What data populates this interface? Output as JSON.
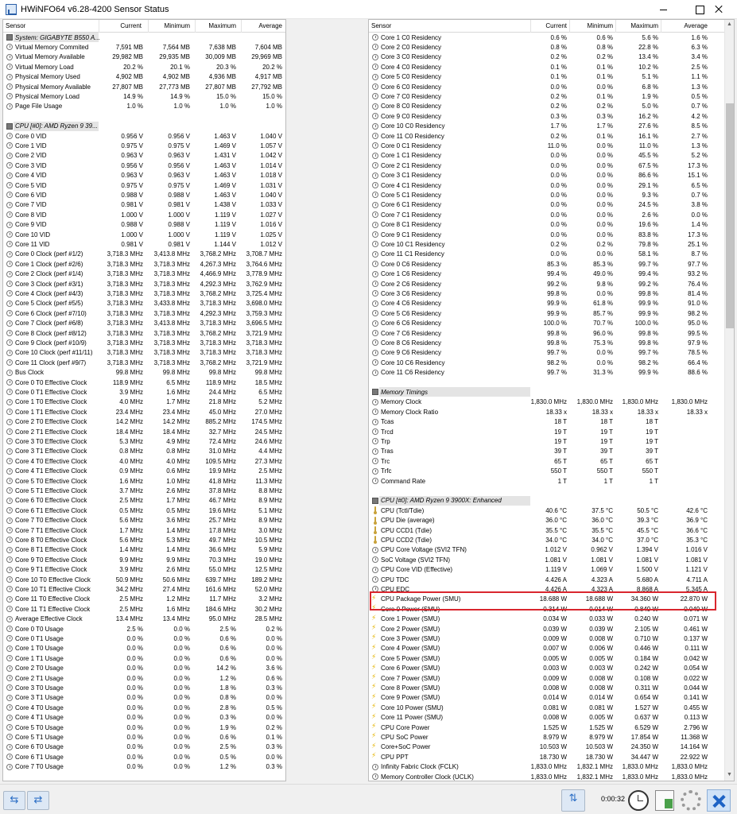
{
  "window": {
    "title": "HWiNFO64 v6.28-4200 Sensor Status"
  },
  "columns": [
    "Sensor",
    "Current",
    "Minimum",
    "Maximum",
    "Average"
  ],
  "left_rows": [
    [
      "group",
      "System: GIGABYTE B550 A..."
    ],
    [
      "circle",
      "Virtual Memory Commited",
      "7,591 MB",
      "7,564 MB",
      "7,638 MB",
      "7,604 MB"
    ],
    [
      "circle",
      "Virtual Memory Available",
      "29,982 MB",
      "29,935 MB",
      "30,009 MB",
      "29,969 MB"
    ],
    [
      "circle",
      "Virtual Memory Load",
      "20.2 %",
      "20.1 %",
      "20.3 %",
      "20.2 %"
    ],
    [
      "circle",
      "Physical Memory Used",
      "4,902 MB",
      "4,902 MB",
      "4,936 MB",
      "4,917 MB"
    ],
    [
      "circle",
      "Physical Memory Available",
      "27,807 MB",
      "27,773 MB",
      "27,807 MB",
      "27,792 MB"
    ],
    [
      "circle",
      "Physical Memory Load",
      "14.9 %",
      "14.9 %",
      "15.0 %",
      "15.0 %"
    ],
    [
      "circle",
      "Page File Usage",
      "1.0 %",
      "1.0 %",
      "1.0 %",
      "1.0 %"
    ],
    [
      "gap"
    ],
    [
      "group",
      "CPU [#0]: AMD Ryzen 9 39..."
    ],
    [
      "circle",
      "Core 0 VID",
      "0.956 V",
      "0.956 V",
      "1.463 V",
      "1.040 V"
    ],
    [
      "circle",
      "Core 1 VID",
      "0.975 V",
      "0.975 V",
      "1.469 V",
      "1.057 V"
    ],
    [
      "circle",
      "Core 2 VID",
      "0.963 V",
      "0.963 V",
      "1.431 V",
      "1.042 V"
    ],
    [
      "circle",
      "Core 3 VID",
      "0.956 V",
      "0.956 V",
      "1.463 V",
      "1.014 V"
    ],
    [
      "circle",
      "Core 4 VID",
      "0.963 V",
      "0.963 V",
      "1.463 V",
      "1.018 V"
    ],
    [
      "circle",
      "Core 5 VID",
      "0.975 V",
      "0.975 V",
      "1.469 V",
      "1.031 V"
    ],
    [
      "circle",
      "Core 6 VID",
      "0.988 V",
      "0.988 V",
      "1.463 V",
      "1.040 V"
    ],
    [
      "circle",
      "Core 7 VID",
      "0.981 V",
      "0.981 V",
      "1.438 V",
      "1.033 V"
    ],
    [
      "circle",
      "Core 8 VID",
      "1.000 V",
      "1.000 V",
      "1.119 V",
      "1.027 V"
    ],
    [
      "circle",
      "Core 9 VID",
      "0.988 V",
      "0.988 V",
      "1.119 V",
      "1.016 V"
    ],
    [
      "circle",
      "Core 10 VID",
      "1.000 V",
      "1.000 V",
      "1.119 V",
      "1.025 V"
    ],
    [
      "circle",
      "Core 11 VID",
      "0.981 V",
      "0.981 V",
      "1.144 V",
      "1.012 V"
    ],
    [
      "circle",
      "Core 0 Clock (perf #1/2)",
      "3,718.3 MHz",
      "3,413.8 MHz",
      "3,768.2 MHz",
      "3,708.7 MHz"
    ],
    [
      "circle",
      "Core 1 Clock (perf #2/6)",
      "3,718.3 MHz",
      "3,718.3 MHz",
      "4,267.3 MHz",
      "3,764.6 MHz"
    ],
    [
      "circle",
      "Core 2 Clock (perf #1/4)",
      "3,718.3 MHz",
      "3,718.3 MHz",
      "4,466.9 MHz",
      "3,778.9 MHz"
    ],
    [
      "circle",
      "Core 3 Clock (perf #3/1)",
      "3,718.3 MHz",
      "3,718.3 MHz",
      "4,292.3 MHz",
      "3,762.9 MHz"
    ],
    [
      "circle",
      "Core 4 Clock (perf #4/3)",
      "3,718.3 MHz",
      "3,718.3 MHz",
      "3,768.2 MHz",
      "3,725.4 MHz"
    ],
    [
      "circle",
      "Core 5 Clock (perf #5/5)",
      "3,718.3 MHz",
      "3,433.8 MHz",
      "3,718.3 MHz",
      "3,698.0 MHz"
    ],
    [
      "circle",
      "Core 6 Clock (perf #7/10)",
      "3,718.3 MHz",
      "3,718.3 MHz",
      "4,292.3 MHz",
      "3,759.3 MHz"
    ],
    [
      "circle",
      "Core 7 Clock (perf #6/8)",
      "3,718.3 MHz",
      "3,413.8 MHz",
      "3,718.3 MHz",
      "3,696.5 MHz"
    ],
    [
      "circle",
      "Core 8 Clock (perf #8/12)",
      "3,718.3 MHz",
      "3,718.3 MHz",
      "3,768.2 MHz",
      "3,721.9 MHz"
    ],
    [
      "circle",
      "Core 9 Clock (perf #10/9)",
      "3,718.3 MHz",
      "3,718.3 MHz",
      "3,718.3 MHz",
      "3,718.3 MHz"
    ],
    [
      "circle",
      "Core 10 Clock (perf #11/11)",
      "3,718.3 MHz",
      "3,718.3 MHz",
      "3,718.3 MHz",
      "3,718.3 MHz"
    ],
    [
      "circle",
      "Core 11 Clock (perf #9/7)",
      "3,718.3 MHz",
      "3,718.3 MHz",
      "3,768.2 MHz",
      "3,721.9 MHz"
    ],
    [
      "circle",
      "Bus Clock",
      "99.8 MHz",
      "99.8 MHz",
      "99.8 MHz",
      "99.8 MHz"
    ],
    [
      "circle",
      "Core 0 T0 Effective Clock",
      "118.9 MHz",
      "6.5 MHz",
      "118.9 MHz",
      "18.5 MHz"
    ],
    [
      "circle",
      "Core 0 T1 Effective Clock",
      "3.9 MHz",
      "1.6 MHz",
      "24.4 MHz",
      "6.5 MHz"
    ],
    [
      "circle",
      "Core 1 T0 Effective Clock",
      "4.0 MHz",
      "1.7 MHz",
      "21.8 MHz",
      "5.2 MHz"
    ],
    [
      "circle",
      "Core 1 T1 Effective Clock",
      "23.4 MHz",
      "23.4 MHz",
      "45.0 MHz",
      "27.0 MHz"
    ],
    [
      "circle",
      "Core 2 T0 Effective Clock",
      "14.2 MHz",
      "14.2 MHz",
      "885.2 MHz",
      "174.5 MHz"
    ],
    [
      "circle",
      "Core 2 T1 Effective Clock",
      "18.4 MHz",
      "18.4 MHz",
      "32.7 MHz",
      "24.5 MHz"
    ],
    [
      "circle",
      "Core 3 T0 Effective Clock",
      "5.3 MHz",
      "4.9 MHz",
      "72.4 MHz",
      "24.6 MHz"
    ],
    [
      "circle",
      "Core 3 T1 Effective Clock",
      "0.8 MHz",
      "0.8 MHz",
      "31.0 MHz",
      "4.4 MHz"
    ],
    [
      "circle",
      "Core 4 T0 Effective Clock",
      "4.0 MHz",
      "4.0 MHz",
      "109.5 MHz",
      "27.3 MHz"
    ],
    [
      "circle",
      "Core 4 T1 Effective Clock",
      "0.9 MHz",
      "0.6 MHz",
      "19.9 MHz",
      "2.5 MHz"
    ],
    [
      "circle",
      "Core 5 T0 Effective Clock",
      "1.6 MHz",
      "1.0 MHz",
      "41.8 MHz",
      "11.3 MHz"
    ],
    [
      "circle",
      "Core 5 T1 Effective Clock",
      "3.7 MHz",
      "2.6 MHz",
      "37.8 MHz",
      "8.8 MHz"
    ],
    [
      "circle",
      "Core 6 T0 Effective Clock",
      "2.5 MHz",
      "1.7 MHz",
      "46.7 MHz",
      "8.9 MHz"
    ],
    [
      "circle",
      "Core 6 T1 Effective Clock",
      "0.5 MHz",
      "0.5 MHz",
      "19.6 MHz",
      "5.1 MHz"
    ],
    [
      "circle",
      "Core 7 T0 Effective Clock",
      "5.6 MHz",
      "3.6 MHz",
      "25.7 MHz",
      "8.9 MHz"
    ],
    [
      "circle",
      "Core 7 T1 Effective Clock",
      "1.7 MHz",
      "1.4 MHz",
      "17.8 MHz",
      "3.0 MHz"
    ],
    [
      "circle",
      "Core 8 T0 Effective Clock",
      "5.6 MHz",
      "5.3 MHz",
      "49.7 MHz",
      "10.5 MHz"
    ],
    [
      "circle",
      "Core 8 T1 Effective Clock",
      "1.4 MHz",
      "1.4 MHz",
      "36.6 MHz",
      "5.9 MHz"
    ],
    [
      "circle",
      "Core 9 T0 Effective Clock",
      "9.9 MHz",
      "9.9 MHz",
      "70.3 MHz",
      "19.0 MHz"
    ],
    [
      "circle",
      "Core 9 T1 Effective Clock",
      "3.9 MHz",
      "2.6 MHz",
      "55.0 MHz",
      "12.5 MHz"
    ],
    [
      "circle",
      "Core 10 T0 Effective Clock",
      "50.9 MHz",
      "50.6 MHz",
      "639.7 MHz",
      "189.2 MHz"
    ],
    [
      "circle",
      "Core 10 T1 Effective Clock",
      "34.2 MHz",
      "27.4 MHz",
      "161.6 MHz",
      "52.0 MHz"
    ],
    [
      "circle",
      "Core 11 T0 Effective Clock",
      "2.5 MHz",
      "1.2 MHz",
      "11.7 MHz",
      "3.2 MHz"
    ],
    [
      "circle",
      "Core 11 T1 Effective Clock",
      "2.5 MHz",
      "1.6 MHz",
      "184.6 MHz",
      "30.2 MHz"
    ],
    [
      "circle",
      "Average Effective Clock",
      "13.4 MHz",
      "13.4 MHz",
      "95.0 MHz",
      "28.5 MHz"
    ],
    [
      "circle",
      "Core 0 T0 Usage",
      "2.5 %",
      "0.0 %",
      "2.5 %",
      "0.2 %"
    ],
    [
      "circle",
      "Core 0 T1 Usage",
      "0.0 %",
      "0.0 %",
      "0.6 %",
      "0.0 %"
    ],
    [
      "circle",
      "Core 1 T0 Usage",
      "0.0 %",
      "0.0 %",
      "0.6 %",
      "0.0 %"
    ],
    [
      "circle",
      "Core 1 T1 Usage",
      "0.0 %",
      "0.0 %",
      "0.6 %",
      "0.0 %"
    ],
    [
      "circle",
      "Core 2 T0 Usage",
      "0.0 %",
      "0.0 %",
      "14.2 %",
      "3.6 %"
    ],
    [
      "circle",
      "Core 2 T1 Usage",
      "0.0 %",
      "0.0 %",
      "1.2 %",
      "0.6 %"
    ],
    [
      "circle",
      "Core 3 T0 Usage",
      "0.0 %",
      "0.0 %",
      "1.8 %",
      "0.3 %"
    ],
    [
      "circle",
      "Core 3 T1 Usage",
      "0.0 %",
      "0.0 %",
      "0.8 %",
      "0.0 %"
    ],
    [
      "circle",
      "Core 4 T0 Usage",
      "0.0 %",
      "0.0 %",
      "2.8 %",
      "0.5 %"
    ],
    [
      "circle",
      "Core 4 T1 Usage",
      "0.0 %",
      "0.0 %",
      "0.3 %",
      "0.0 %"
    ],
    [
      "circle",
      "Core 5 T0 Usage",
      "0.0 %",
      "0.0 %",
      "1.9 %",
      "0.2 %"
    ],
    [
      "circle",
      "Core 5 T1 Usage",
      "0.0 %",
      "0.0 %",
      "0.6 %",
      "0.1 %"
    ],
    [
      "circle",
      "Core 6 T0 Usage",
      "0.0 %",
      "0.0 %",
      "2.5 %",
      "0.3 %"
    ],
    [
      "circle",
      "Core 6 T1 Usage",
      "0.0 %",
      "0.0 %",
      "0.5 %",
      "0.0 %"
    ],
    [
      "circle",
      "Core 7 T0 Usage",
      "0.0 %",
      "0.0 %",
      "1.2 %",
      "0.3 %"
    ]
  ],
  "right_rows": [
    [
      "circle",
      "Core 1 C0 Residency",
      "0.6 %",
      "0.6 %",
      "5.6 %",
      "1.6 %"
    ],
    [
      "circle",
      "Core 2 C0 Residency",
      "0.8 %",
      "0.8 %",
      "22.8 %",
      "6.3 %"
    ],
    [
      "circle",
      "Core 3 C0 Residency",
      "0.2 %",
      "0.2 %",
      "13.4 %",
      "3.4 %"
    ],
    [
      "circle",
      "Core 4 C0 Residency",
      "0.1 %",
      "0.1 %",
      "10.2 %",
      "2.5 %"
    ],
    [
      "circle",
      "Core 5 C0 Residency",
      "0.1 %",
      "0.1 %",
      "5.1 %",
      "1.1 %"
    ],
    [
      "circle",
      "Core 6 C0 Residency",
      "0.0 %",
      "0.0 %",
      "6.8 %",
      "1.3 %"
    ],
    [
      "circle",
      "Core 7 C0 Residency",
      "0.2 %",
      "0.1 %",
      "1.9 %",
      "0.5 %"
    ],
    [
      "circle",
      "Core 8 C0 Residency",
      "0.2 %",
      "0.2 %",
      "5.0 %",
      "0.7 %"
    ],
    [
      "circle",
      "Core 9 C0 Residency",
      "0.3 %",
      "0.3 %",
      "16.2 %",
      "4.2 %"
    ],
    [
      "circle",
      "Core 10 C0 Residency",
      "1.7 %",
      "1.7 %",
      "27.6 %",
      "8.5 %"
    ],
    [
      "circle",
      "Core 11 C0 Residency",
      "0.2 %",
      "0.1 %",
      "16.1 %",
      "2.7 %"
    ],
    [
      "circle",
      "Core 0 C1 Residency",
      "11.0 %",
      "0.0 %",
      "11.0 %",
      "1.3 %"
    ],
    [
      "circle",
      "Core 1 C1 Residency",
      "0.0 %",
      "0.0 %",
      "45.5 %",
      "5.2 %"
    ],
    [
      "circle",
      "Core 2 C1 Residency",
      "0.0 %",
      "0.0 %",
      "67.5 %",
      "17.3 %"
    ],
    [
      "circle",
      "Core 3 C1 Residency",
      "0.0 %",
      "0.0 %",
      "86.6 %",
      "15.1 %"
    ],
    [
      "circle",
      "Core 4 C1 Residency",
      "0.0 %",
      "0.0 %",
      "29.1 %",
      "6.5 %"
    ],
    [
      "circle",
      "Core 5 C1 Residency",
      "0.0 %",
      "0.0 %",
      "9.3 %",
      "0.7 %"
    ],
    [
      "circle",
      "Core 6 C1 Residency",
      "0.0 %",
      "0.0 %",
      "24.5 %",
      "3.8 %"
    ],
    [
      "circle",
      "Core 7 C1 Residency",
      "0.0 %",
      "0.0 %",
      "2.6 %",
      "0.0 %"
    ],
    [
      "circle",
      "Core 8 C1 Residency",
      "0.0 %",
      "0.0 %",
      "19.6 %",
      "1.4 %"
    ],
    [
      "circle",
      "Core 9 C1 Residency",
      "0.0 %",
      "0.0 %",
      "83.8 %",
      "17.3 %"
    ],
    [
      "circle",
      "Core 10 C1 Residency",
      "0.2 %",
      "0.2 %",
      "79.8 %",
      "25.1 %"
    ],
    [
      "circle",
      "Core 11 C1 Residency",
      "0.0 %",
      "0.0 %",
      "58.1 %",
      "8.7 %"
    ],
    [
      "circle",
      "Core 0 C6 Residency",
      "85.3 %",
      "85.3 %",
      "99.7 %",
      "97.7 %"
    ],
    [
      "circle",
      "Core 1 C6 Residency",
      "99.4 %",
      "49.0 %",
      "99.4 %",
      "93.2 %"
    ],
    [
      "circle",
      "Core 2 C6 Residency",
      "99.2 %",
      "9.8 %",
      "99.2 %",
      "76.4 %"
    ],
    [
      "circle",
      "Core 3 C6 Residency",
      "99.8 %",
      "0.0 %",
      "99.8 %",
      "81.4 %"
    ],
    [
      "circle",
      "Core 4 C6 Residency",
      "99.9 %",
      "61.8 %",
      "99.9 %",
      "91.0 %"
    ],
    [
      "circle",
      "Core 5 C6 Residency",
      "99.9 %",
      "85.7 %",
      "99.9 %",
      "98.2 %"
    ],
    [
      "circle",
      "Core 6 C6 Residency",
      "100.0 %",
      "70.7 %",
      "100.0 %",
      "95.0 %"
    ],
    [
      "circle",
      "Core 7 C6 Residency",
      "99.8 %",
      "96.0 %",
      "99.8 %",
      "99.5 %"
    ],
    [
      "circle",
      "Core 8 C6 Residency",
      "99.8 %",
      "75.3 %",
      "99.8 %",
      "97.9 %"
    ],
    [
      "circle",
      "Core 9 C6 Residency",
      "99.7 %",
      "0.0 %",
      "99.7 %",
      "78.5 %"
    ],
    [
      "circle",
      "Core 10 C6 Residency",
      "98.2 %",
      "0.0 %",
      "98.2 %",
      "66.4 %"
    ],
    [
      "circle",
      "Core 11 C6 Residency",
      "99.7 %",
      "31.3 %",
      "99.9 %",
      "88.6 %"
    ],
    [
      "gap"
    ],
    [
      "group",
      "Memory Timings"
    ],
    [
      "circle",
      "Memory Clock",
      "1,830.0 MHz",
      "1,830.0 MHz",
      "1,830.0 MHz",
      "1,830.0 MHz"
    ],
    [
      "circle",
      "Memory Clock Ratio",
      "18.33 x",
      "18.33 x",
      "18.33 x",
      "18.33 x"
    ],
    [
      "circle",
      "Tcas",
      "18 T",
      "18 T",
      "18 T",
      ""
    ],
    [
      "circle",
      "Trcd",
      "19 T",
      "19 T",
      "19 T",
      ""
    ],
    [
      "circle",
      "Trp",
      "19 T",
      "19 T",
      "19 T",
      ""
    ],
    [
      "circle",
      "Tras",
      "39 T",
      "39 T",
      "39 T",
      ""
    ],
    [
      "circle",
      "Trc",
      "65 T",
      "65 T",
      "65 T",
      ""
    ],
    [
      "circle",
      "Trfc",
      "550 T",
      "550 T",
      "550 T",
      ""
    ],
    [
      "circle",
      "Command Rate",
      "1 T",
      "1 T",
      "1 T",
      ""
    ],
    [
      "gap"
    ],
    [
      "group",
      "CPU [#0]: AMD Ryzen 9 3900X: Enhanced"
    ],
    [
      "therm",
      "CPU (Tctl/Tdie)",
      "40.6 °C",
      "37.5 °C",
      "50.5 °C",
      "42.6 °C"
    ],
    [
      "therm",
      "CPU Die (average)",
      "36.0 °C",
      "36.0 °C",
      "39.3 °C",
      "36.9 °C"
    ],
    [
      "therm",
      "CPU CCD1 (Tdie)",
      "35.5 °C",
      "35.5 °C",
      "45.5 °C",
      "36.6 °C"
    ],
    [
      "therm",
      "CPU CCD2 (Tdie)",
      "34.0 °C",
      "34.0 °C",
      "37.0 °C",
      "35.3 °C"
    ],
    [
      "circle",
      "CPU Core Voltage (SVI2 TFN)",
      "1.012 V",
      "0.962 V",
      "1.394 V",
      "1.016 V"
    ],
    [
      "circle",
      "SoC Voltage (SVI2 TFN)",
      "1.081 V",
      "1.081 V",
      "1.081 V",
      "1.081 V"
    ],
    [
      "circle",
      "CPU Core VID (Effective)",
      "1.119 V",
      "1.069 V",
      "1.500 V",
      "1.121 V"
    ],
    [
      "circle",
      "CPU TDC",
      "4.426 A",
      "4.323 A",
      "5.680 A",
      "4.711 A"
    ],
    [
      "circle",
      "CPU EDC",
      "4.426 A",
      "4.323 A",
      "8.868 A",
      "5.345 A"
    ],
    [
      "bolt",
      "CPU Package Power (SMU)",
      "18.688 W",
      "18.688 W",
      "34.360 W",
      "22.870 W"
    ],
    [
      "bolt",
      "Core 0 Power (SMU)",
      "0.314 W",
      "0.014 W",
      "0.849 W",
      "0.049 W"
    ],
    [
      "bolt",
      "Core 1 Power (SMU)",
      "0.034 W",
      "0.033 W",
      "0.240 W",
      "0.071 W"
    ],
    [
      "bolt",
      "Core 2 Power (SMU)",
      "0.039 W",
      "0.039 W",
      "2.105 W",
      "0.461 W"
    ],
    [
      "bolt",
      "Core 3 Power (SMU)",
      "0.009 W",
      "0.008 W",
      "0.710 W",
      "0.137 W"
    ],
    [
      "bolt",
      "Core 4 Power (SMU)",
      "0.007 W",
      "0.006 W",
      "0.446 W",
      "0.111 W"
    ],
    [
      "bolt",
      "Core 5 Power (SMU)",
      "0.005 W",
      "0.005 W",
      "0.184 W",
      "0.042 W"
    ],
    [
      "bolt",
      "Core 6 Power (SMU)",
      "0.003 W",
      "0.003 W",
      "0.242 W",
      "0.054 W"
    ],
    [
      "bolt",
      "Core 7 Power (SMU)",
      "0.009 W",
      "0.008 W",
      "0.108 W",
      "0.022 W"
    ],
    [
      "bolt",
      "Core 8 Power (SMU)",
      "0.008 W",
      "0.008 W",
      "0.311 W",
      "0.044 W"
    ],
    [
      "bolt",
      "Core 9 Power (SMU)",
      "0.014 W",
      "0.014 W",
      "0.654 W",
      "0.141 W"
    ],
    [
      "bolt",
      "Core 10 Power (SMU)",
      "0.081 W",
      "0.081 W",
      "1.527 W",
      "0.455 W"
    ],
    [
      "bolt",
      "Core 11 Power (SMU)",
      "0.008 W",
      "0.005 W",
      "0.637 W",
      "0.113 W"
    ],
    [
      "bolt",
      "CPU Core Power",
      "1.525 W",
      "1.525 W",
      "6.529 W",
      "2.796 W"
    ],
    [
      "bolt",
      "CPU SoC Power",
      "8.979 W",
      "8.979 W",
      "17.854 W",
      "11.368 W"
    ],
    [
      "bolt",
      "Core+SoC Power",
      "10.503 W",
      "10.503 W",
      "24.350 W",
      "14.164 W"
    ],
    [
      "bolt",
      "CPU PPT",
      "18.730 W",
      "18.730 W",
      "34.447 W",
      "22.922 W"
    ],
    [
      "circle",
      "Infinity Fabric Clock (FCLK)",
      "1,833.0 MHz",
      "1,832.1 MHz",
      "1,833.0 MHz",
      "1,833.0 MHz"
    ],
    [
      "circle",
      "Memory Controller Clock (UCLK)",
      "1,833.0 MHz",
      "1,832.1 MHz",
      "1,833.0 MHz",
      "1,833.0 MHz"
    ]
  ],
  "statusbar": {
    "timer": "0:00:32"
  },
  "icons": {
    "nav_left": "arrows-left-right-icon",
    "nav_right": "arrows-in-out-icon",
    "network": "network-icon",
    "clock": "clock-icon",
    "report": "report-icon",
    "settings": "gear-icon",
    "close": "close-icon"
  },
  "colors": {
    "highlight": "#d9262e",
    "accent": "#2c6ec5"
  }
}
